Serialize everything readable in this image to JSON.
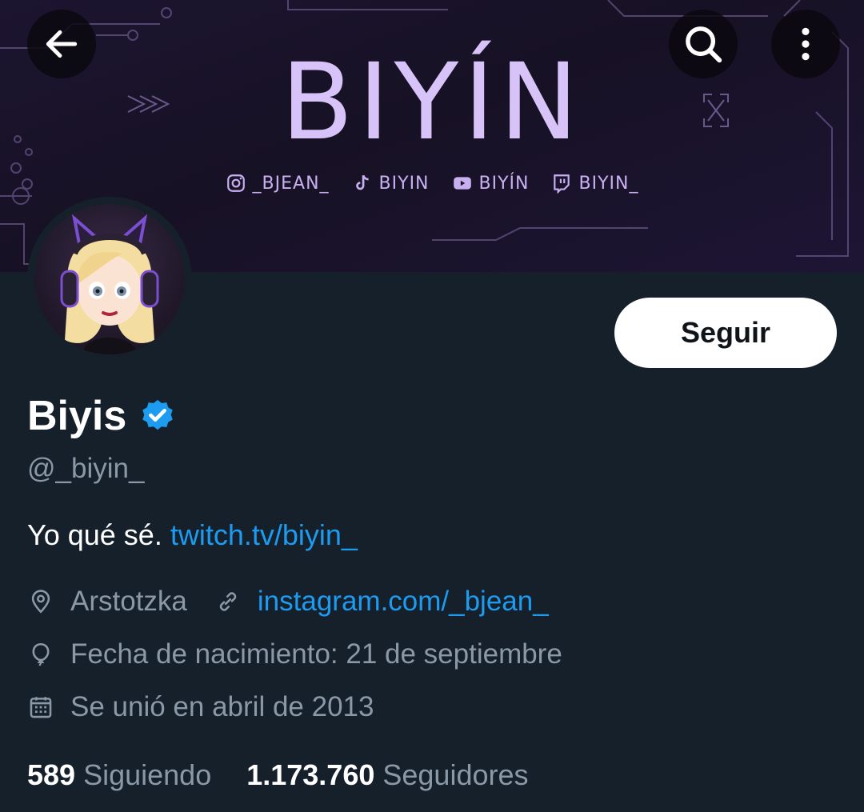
{
  "banner": {
    "brand": "BIYÍN",
    "socials": [
      {
        "icon": "instagram-icon",
        "label": "_BJEAN_"
      },
      {
        "icon": "tiktok-icon",
        "label": "BIYIN"
      },
      {
        "icon": "youtube-icon",
        "label": "BIYÍN"
      },
      {
        "icon": "twitch-icon",
        "label": "BIYIN_"
      }
    ]
  },
  "header": {
    "back_icon": "back-arrow-icon",
    "search_icon": "search-icon",
    "more_icon": "more-vertical-icon"
  },
  "profile": {
    "name": "Biyis",
    "verified_icon": "verified-badge-icon",
    "handle": "@_biyin_",
    "follow_label": "Seguir",
    "bio_text": "Yo qué sé.",
    "bio_link": "twitch.tv/biyin_",
    "location": "Arstotzka",
    "website": "instagram.com/_bjean_",
    "birthday": "Fecha de nacimiento: 21 de septiembre",
    "joined": "Se unió en abril de 2013",
    "following_count": "589",
    "following_label": "Siguiendo",
    "followers_count": "1.173.760",
    "followers_label": "Seguidores"
  },
  "colors": {
    "background": "#15202b",
    "accent": "#1d9bf0",
    "muted": "#8b98a5",
    "banner_text": "#d7c3f7"
  }
}
